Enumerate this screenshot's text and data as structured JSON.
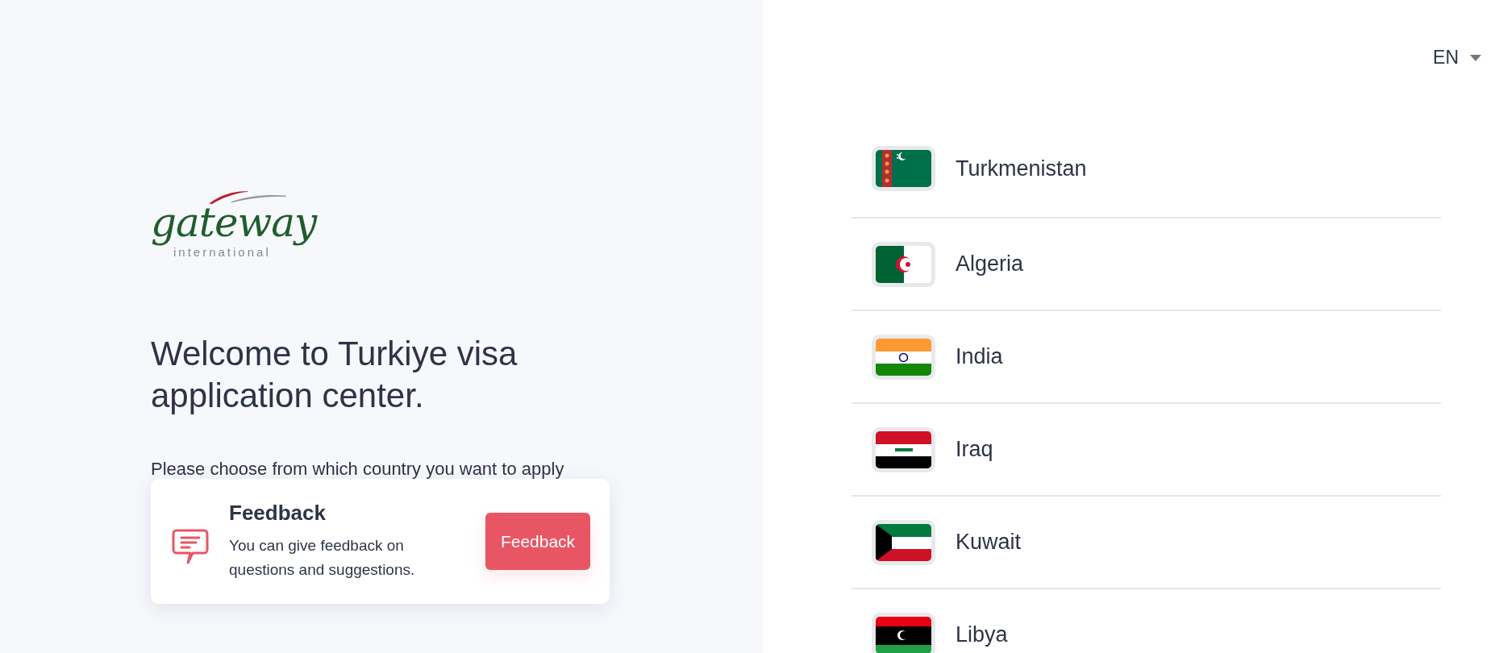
{
  "logo": {
    "name": "gateway",
    "subtitle": "international"
  },
  "heading": "Welcome to Turkiye visa application center.",
  "instruction": "Please choose from which country you want to apply",
  "feedback_card": {
    "title": "Feedback",
    "text": "You can give feedback on questions and suggestions.",
    "button": "Feedback"
  },
  "language": {
    "label": "EN"
  },
  "countries": [
    {
      "name": "Turkmenistan",
      "kind": "turkmenistan"
    },
    {
      "name": "Algeria",
      "kind": "algeria"
    },
    {
      "name": "India",
      "kind": "india"
    },
    {
      "name": "Iraq",
      "kind": "iraq"
    },
    {
      "name": "Kuwait",
      "kind": "kuwait"
    },
    {
      "name": "Libya",
      "kind": "libya"
    }
  ]
}
